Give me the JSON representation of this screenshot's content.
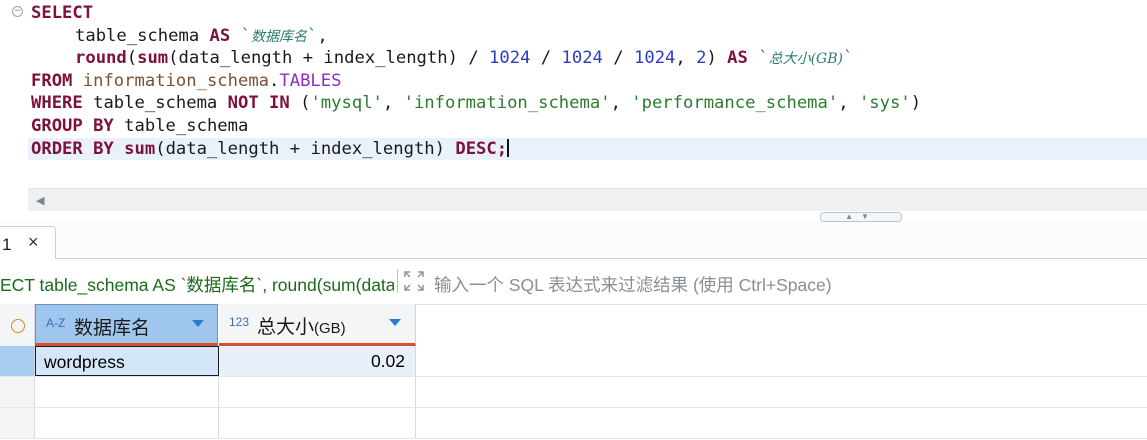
{
  "editor": {
    "sql": {
      "select": "SELECT",
      "col1": "table_schema",
      "as": "AS",
      "alias1": "数据库名",
      "comma": ",",
      "round": "round",
      "sum": "sum",
      "data_length": "data_length",
      "plus": "+",
      "index_length": "index_length",
      "div": "/",
      "n1024": "1024",
      "n2": "2",
      "alias2": "总大小(GB)",
      "from": "FROM",
      "schema": "information_schema",
      "dot": ".",
      "tables": "TABLES",
      "where": "WHERE",
      "col_schema": "table_schema",
      "not_in": "NOT IN",
      "s1": "'mysql'",
      "s2": "'information_schema'",
      "s3": "'performance_schema'",
      "s4": "'sys'",
      "group_by": "GROUP BY",
      "order_by": "ORDER BY",
      "desc": "DESC;"
    }
  },
  "results": {
    "tab_label": "1",
    "tab_close": "×",
    "filter_query": "ECT table_schema AS `数据库名`, round(sum(data_",
    "filter_placeholder": "输入一个 SQL 表达式来过滤结果 (使用 Ctrl+Space)",
    "columns": [
      {
        "type_icon": "A-Z",
        "title": "数据库名",
        "unit": ""
      },
      {
        "type_icon": "123",
        "title": "总大小",
        "unit": "(GB)"
      }
    ],
    "rows": [
      {
        "name": "wordpress",
        "size": "0.02"
      }
    ]
  }
}
